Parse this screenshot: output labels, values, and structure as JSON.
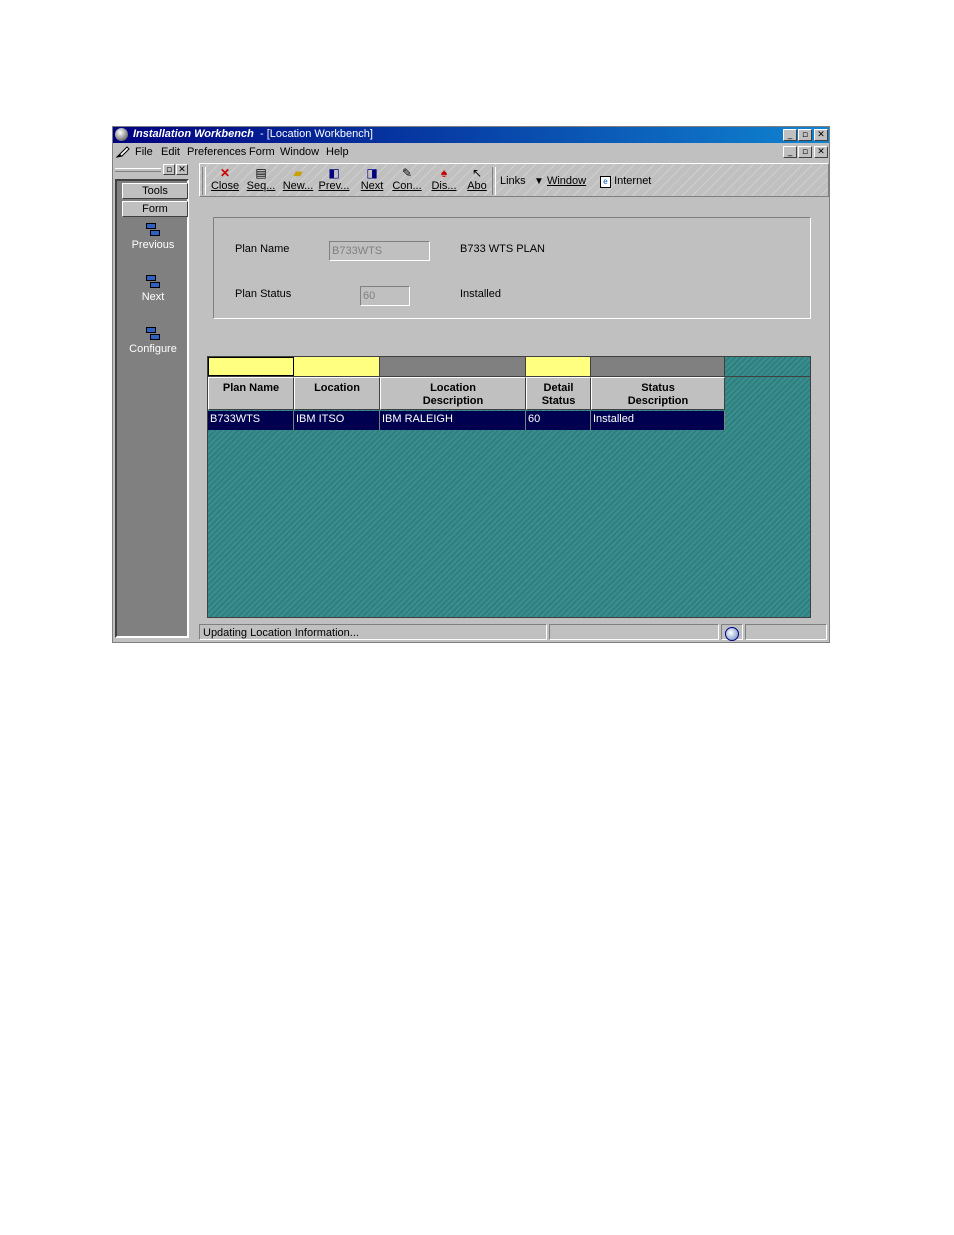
{
  "window": {
    "app_title": "Installation Workbench",
    "form_title": "- [Location Workbench]",
    "controls": [
      "_",
      "▫",
      "✕"
    ]
  },
  "menu": [
    "File",
    "Edit",
    "Preferences",
    "Form",
    "Window",
    "Help"
  ],
  "left_panel": {
    "tabs": [
      "Tools",
      "Form"
    ],
    "items": [
      "Previous",
      "Next",
      "Configure"
    ]
  },
  "toolbar": {
    "buttons": [
      "Close",
      "Seq...",
      "New...",
      "Prev...",
      "Next",
      "Con...",
      "Dis...",
      "Abo"
    ],
    "links": [
      "Links",
      "Window",
      "Internet"
    ]
  },
  "form": {
    "plan_name_label": "Plan Name",
    "plan_name_value": "B733WTS",
    "plan_name_desc": "B733 WTS PLAN",
    "plan_status_label": "Plan Status",
    "plan_status_value": "60",
    "plan_status_desc": "Installed"
  },
  "grid": {
    "columns": [
      {
        "l1": "Plan Name",
        "l2": ""
      },
      {
        "l1": "Location",
        "l2": ""
      },
      {
        "l1": "Location",
        "l2": "Description"
      },
      {
        "l1": "Detail",
        "l2": "Status"
      },
      {
        "l1": "Status",
        "l2": "Description"
      }
    ],
    "rows": [
      [
        "B733WTS",
        "IBM ITSO",
        "IBM RALEIGH",
        "60",
        "Installed"
      ]
    ]
  },
  "status_bar": {
    "message": "Updating Location Information..."
  },
  "colors": {
    "title_start": "#000080",
    "qbe_yellow": "#ffff80",
    "grid_teal": "#2f7f7f",
    "selected_row": "#000050"
  }
}
